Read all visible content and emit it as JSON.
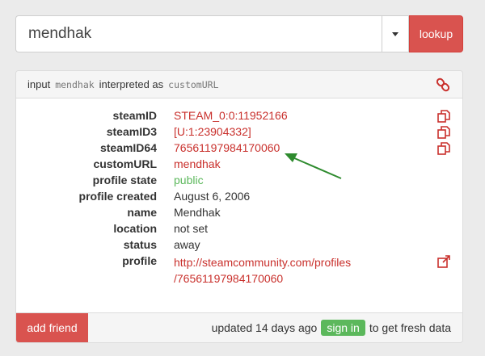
{
  "search": {
    "value": "mendhak",
    "lookup_label": "lookup"
  },
  "panel": {
    "heading_prefix": "input",
    "heading_input": "mendhak",
    "heading_middle": "interpreted as",
    "heading_type": "customURL"
  },
  "details": [
    {
      "label": "steamID",
      "value": "STEAM_0:0:11952166",
      "copyable": true
    },
    {
      "label": "steamID3",
      "value": "[U:1:23904332]",
      "copyable": true
    },
    {
      "label": "steamID64",
      "value": "76561197984170060",
      "copyable": true
    },
    {
      "label": "customURL",
      "value": "mendhak"
    },
    {
      "label": "profile state",
      "value": "public"
    },
    {
      "label": "profile created",
      "value": "August 6, 2006"
    },
    {
      "label": "name",
      "value": "Mendhak"
    },
    {
      "label": "location",
      "value": "not set"
    },
    {
      "label": "status",
      "value": "away"
    },
    {
      "label": "profile",
      "value_line1": "http://steamcommunity.com/profiles",
      "value_line2": "/76561197984170060"
    }
  ],
  "footer": {
    "add_friend_label": "add friend",
    "updated_text": "updated 14 days ago",
    "signin_label": "sign in",
    "suffix_text": "to get fresh data"
  },
  "colors": {
    "accent_red": "#d9534f",
    "link_red": "#c9302c",
    "green": "#5cb85c",
    "arrow_green": "#2e8b2e"
  },
  "icons": [
    "chevron-down-icon",
    "link-icon",
    "copy-icon",
    "external-link-icon"
  ]
}
